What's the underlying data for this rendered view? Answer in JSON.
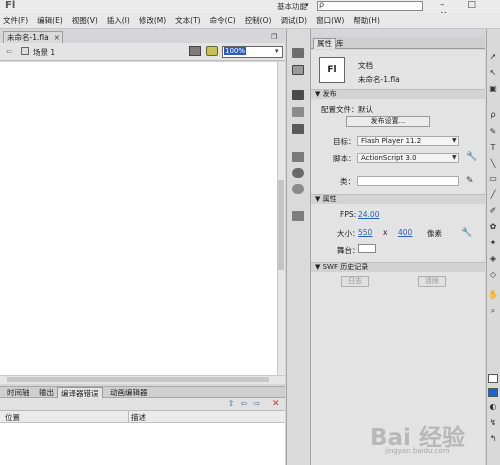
{
  "app": {
    "logo": "Fl",
    "workspace": "基本功能",
    "search_glyph": "ρ",
    "window_controls": "– □ ×"
  },
  "menu": [
    "文件(F)",
    "编辑(E)",
    "视图(V)",
    "插入(I)",
    "修改(M)",
    "文本(T)",
    "命令(C)",
    "控制(O)",
    "调试(D)",
    "窗口(W)",
    "帮助(H)"
  ],
  "document_tab": {
    "label": "未命名-1.fla",
    "close": "×"
  },
  "editbar": {
    "back": "⇐",
    "scene": "场景 1",
    "zoom": "100%"
  },
  "bottom_panel": {
    "tabs": [
      "时间轴",
      "输出",
      "编译器错误",
      "动画编辑器"
    ],
    "active_tab": 2,
    "columns": {
      "position": "位置",
      "description": "描述"
    },
    "toolbar_glyphs": [
      "⇧",
      "⇦",
      "⇨"
    ],
    "close_glyph": "✕"
  },
  "properties": {
    "tabs": [
      "属性",
      "库"
    ],
    "doc_icon": "Fl",
    "doc_type": "文档",
    "doc_name": "未命名-1.fla",
    "publish_section": "发布",
    "profile_label": "配置文件：",
    "profile_value": "默认",
    "publish_settings_button": "发布设置...",
    "target_label": "目标：",
    "target_value": "Flash Player 11.2",
    "script_label": "脚本：",
    "script_value": "ActionScript 3.0",
    "class_label": "类：",
    "class_value": "",
    "props_section": "属性",
    "fps_label": "FPS:",
    "fps_value": "24.00",
    "size_label": "大小：",
    "width": "550",
    "x_sep": "x",
    "height": "400",
    "unit": "像素",
    "stage_label": "舞台：",
    "stage_color": "#ffffff",
    "swf_section": "SWF 历史记录",
    "log_button": "日志",
    "clear_button": "清除"
  },
  "tool_glyphs": [
    "➚",
    "↖",
    "▣",
    "ρ",
    "✎",
    "T",
    "╲",
    "▭",
    "╱",
    "✐",
    "✿",
    "✦",
    "◈",
    "◇",
    "✋",
    "⌕"
  ],
  "colors": {
    "accent_fill": "#1e63d6",
    "stroke": "#ffffff"
  },
  "watermark": {
    "logo": "Bai 经验",
    "sub": "jingyan.baidu.com"
  }
}
